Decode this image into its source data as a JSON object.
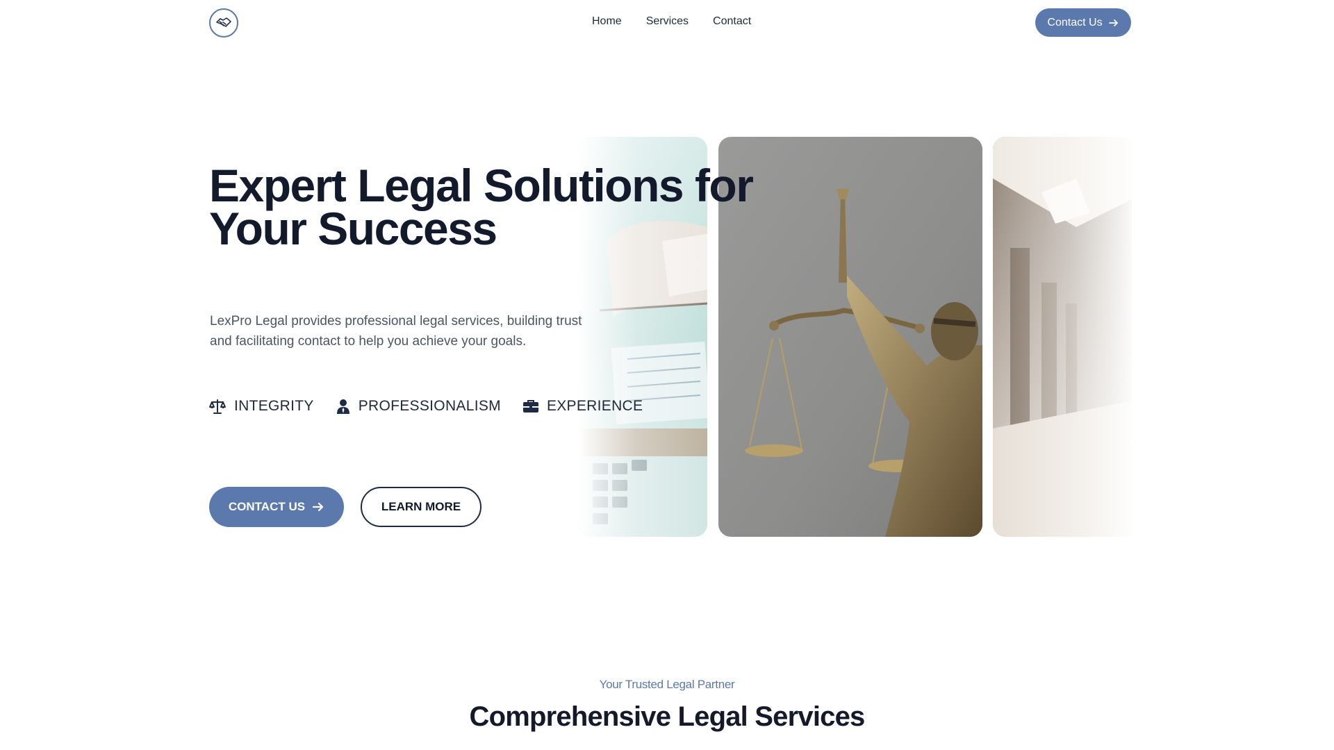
{
  "nav": {
    "logo_icon": "handshake-icon",
    "links": [
      "Home",
      "Services",
      "Contact"
    ],
    "cta_label": "Contact Us"
  },
  "hero": {
    "title_line1": "Expert Legal Solutions for",
    "title_line2": "Your Success",
    "description": "LexPro Legal provides professional legal services, building trust and facilitating contact to help you achieve your goals.",
    "values": [
      {
        "icon": "scales-icon",
        "label": "INTEGRITY"
      },
      {
        "icon": "person-icon",
        "label": "PROFESSIONALISM"
      },
      {
        "icon": "briefcase-icon",
        "label": "EXPERIENCE"
      }
    ],
    "primary_button": "CONTACT US",
    "secondary_button": "LEARN MORE"
  },
  "images": [
    {
      "name": "signing-document-image"
    },
    {
      "name": "lady-justice-statue-image"
    },
    {
      "name": "office-corridor-image"
    }
  ],
  "section": {
    "eyebrow": "Your Trusted Legal Partner",
    "title": "Comprehensive Legal Services"
  },
  "colors": {
    "accent": "#5b79ad",
    "heading": "#131a2c",
    "body_text": "#4b5563",
    "background": "#ffffff"
  }
}
